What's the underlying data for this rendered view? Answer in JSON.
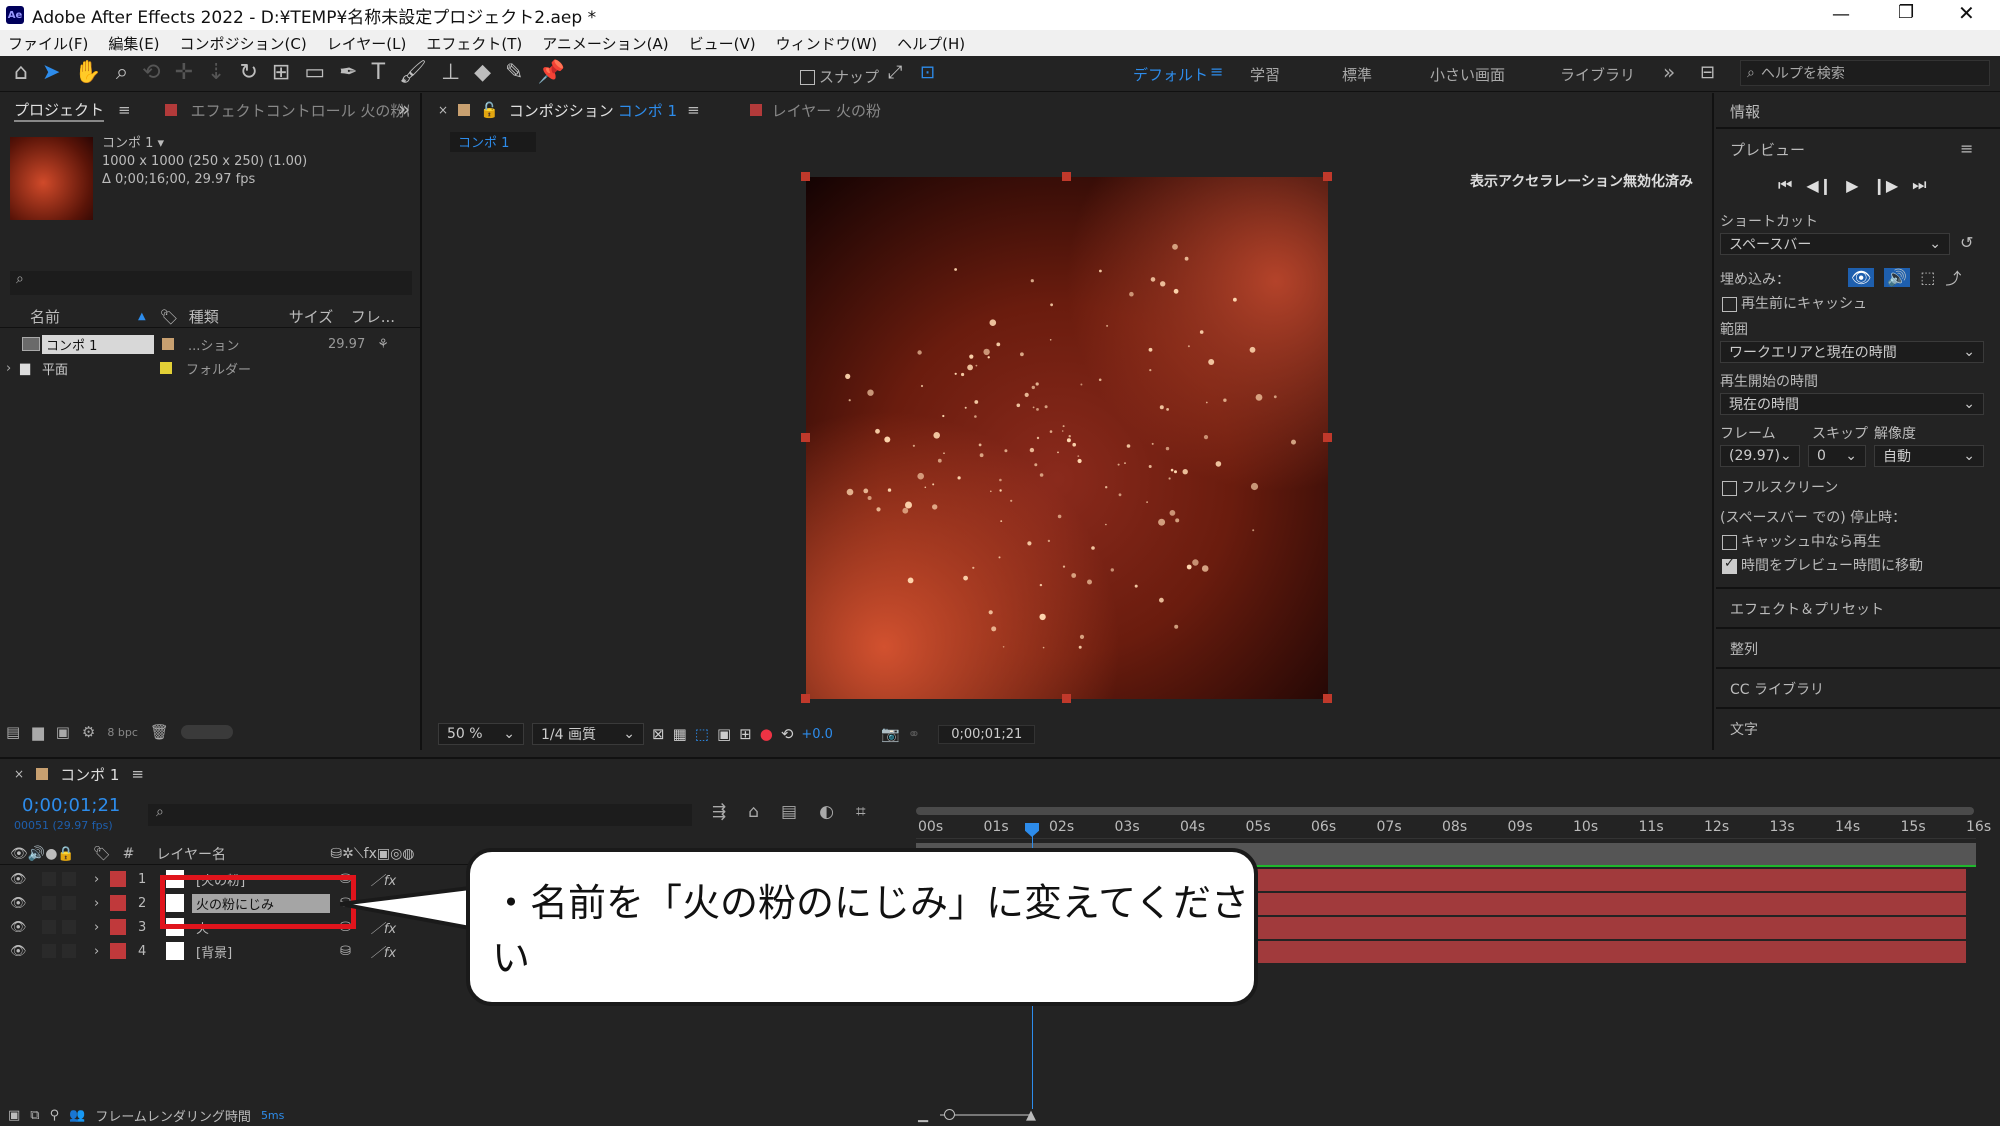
{
  "window": {
    "app_icon": "Ae",
    "title": "Adobe After Effects 2022 - D:¥TEMP¥名称未設定プロジェクト2.aep *",
    "controls": [
      "minimize-icon",
      "restore-icon",
      "close-icon"
    ]
  },
  "menu": [
    "ファイル(F)",
    "編集(E)",
    "コンポジション(C)",
    "レイヤー(L)",
    "エフェクト(T)",
    "アニメーション(A)",
    "ビュー(V)",
    "ウィンドウ(W)",
    "ヘルプ(H)"
  ],
  "toolbar": {
    "snap_label": "スナップ",
    "workspaces": [
      "デフォルト",
      "学習",
      "標準",
      "小さい画面",
      "ライブラリ"
    ],
    "search_placeholder": "ヘルプを検索",
    "overflow": "»"
  },
  "project": {
    "tab_label": "プロジェクト",
    "effects_tab_label": "エフェクトコントロール 火の粉に",
    "item_name": "コンポ 1 ▾",
    "item_dims": "1000 x 1000  (250 x 250) (1.00)",
    "item_duration": "Δ 0;00;16;00, 29.97 fps",
    "columns": [
      "名前",
      "種類",
      "サイズ",
      "フレ..."
    ],
    "rows": [
      {
        "name": "コンポ 1",
        "type": "...ション",
        "fps": "29.97"
      },
      {
        "name": "平面",
        "type": "フォルダー",
        "fps": ""
      }
    ],
    "bpc": "8 bpc"
  },
  "composition": {
    "tab_label": "コンポジション",
    "comp_name": "コンポ 1",
    "layer_tab": "レイヤー 火の粉",
    "sub_tab": "コンポ 1",
    "notice": "表示アクセラレーション無効化済み",
    "zoom": "50 %",
    "quality": "1/4 画質",
    "exposure": "+0.0",
    "timecode": "0;00;01;21"
  },
  "preview": {
    "info_label": "情報",
    "preview_label": "プレビュー",
    "shortcut_label": "ショートカット",
    "shortcut_value": "スペースバー",
    "include_label": "埋め込み：",
    "cache_before": "再生前にキャッシュ",
    "range_label": "範囲",
    "range_value": "ワークエリアと現在の時間",
    "play_from_label": "再生開始の時間",
    "play_from_value": "現在の時間",
    "frame_label": "フレーム",
    "skip_label": "スキップ",
    "resolution_label": "解像度",
    "frame_value": "(29.97)",
    "skip_value": "0",
    "resolution_value": "自動",
    "fullscreen": "フルスクリーン",
    "stop_label": "(スペースバー での) 停止時：",
    "cache_play": "キャッシュ中なら再生",
    "move_time": "時間をプレビュー時間に移動",
    "effects_presets": "エフェクト＆プリセット",
    "align": "整列",
    "cc_libraries": "CC ライブラリ",
    "text": "文字"
  },
  "timeline": {
    "tab_label": "コンポ 1",
    "timecode": "0;00;01;21",
    "fps_sub": "00051 (29.97 fps)",
    "layer_name_header": "レイヤー名",
    "hash_header": "#",
    "ruler": [
      "00s",
      "01s",
      "02s",
      "03s",
      "04s",
      "05s",
      "06s",
      "07s",
      "08s",
      "09s",
      "10s",
      "11s",
      "12s",
      "13s",
      "14s",
      "15s",
      "16s"
    ],
    "layers": [
      {
        "num": "1",
        "name": "[火の粉]"
      },
      {
        "num": "2",
        "name": "火の粉にじみ"
      },
      {
        "num": "3",
        "name": "火"
      },
      {
        "num": "4",
        "name": "[背景]"
      }
    ],
    "render_label": "フレームレンダリング時間",
    "render_value": "5ms"
  },
  "callout": {
    "text": "・名前を「火の粉のにじみ」に変えてください"
  },
  "colors": {
    "accent": "#2d8ceb",
    "layer_red": "#a13a3c",
    "highlight": "#e0141c",
    "bg": "#232323"
  }
}
